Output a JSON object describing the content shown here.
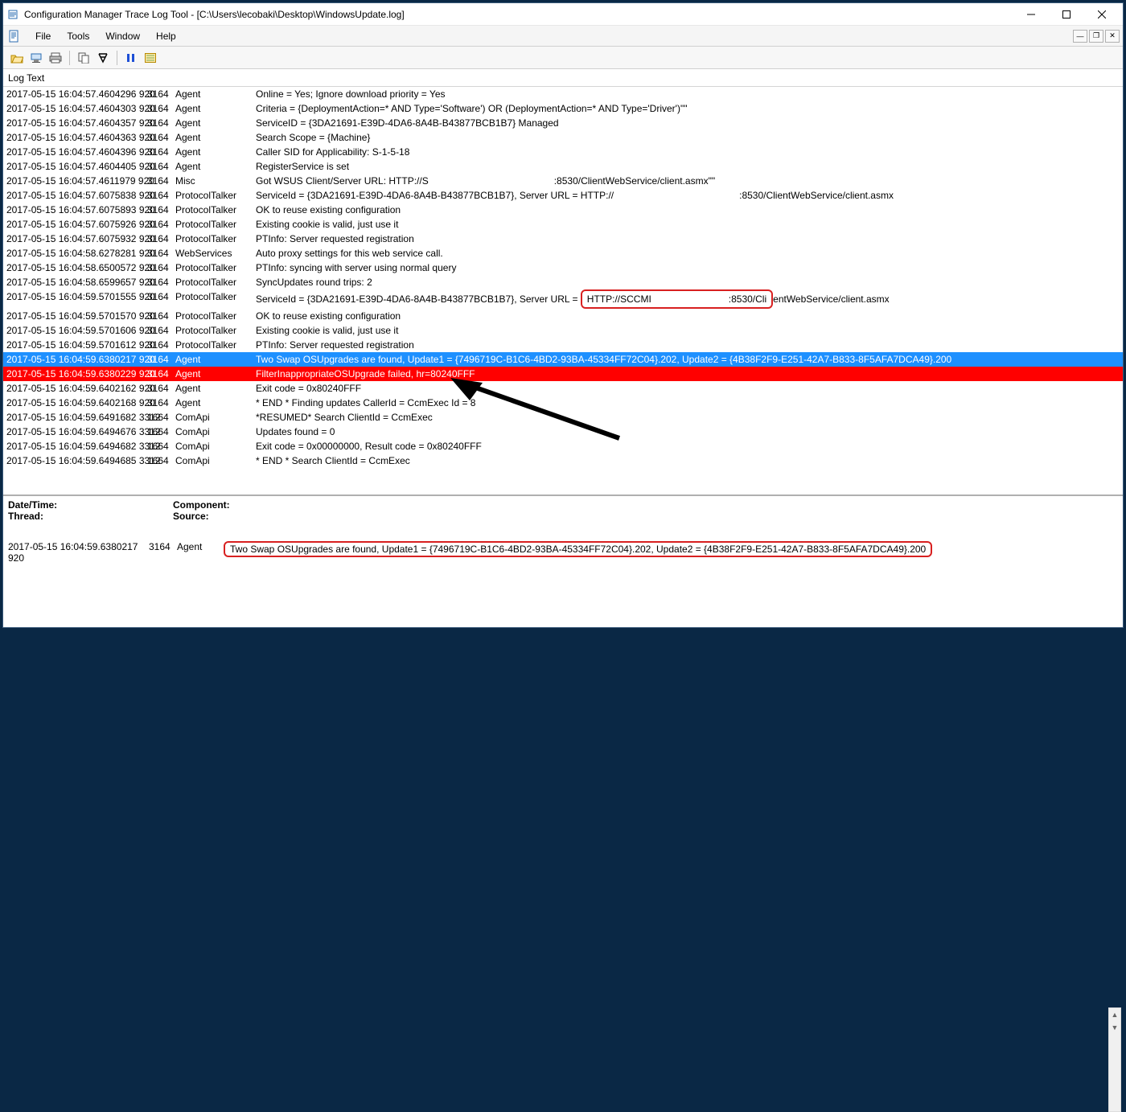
{
  "window": {
    "title": "Configuration Manager Trace Log Tool - [C:\\Users\\lecobaki\\Desktop\\WindowsUpdate.log]"
  },
  "menu": {
    "file": "File",
    "tools": "Tools",
    "window": "Window",
    "help": "Help"
  },
  "grid": {
    "header": "Log Text"
  },
  "rows": [
    {
      "ts": "2017-05-15 16:04:57.4604296 920",
      "pid": "3164",
      "comp": "Agent",
      "msg": "    Online = Yes; Ignore download priority = Yes"
    },
    {
      "ts": "2017-05-15 16:04:57.4604303 920",
      "pid": "3164",
      "comp": "Agent",
      "msg": "    Criteria = {DeploymentAction=* AND Type='Software') OR (DeploymentAction=* AND Type='Driver')\"\""
    },
    {
      "ts": "2017-05-15 16:04:57.4604357 920",
      "pid": "3164",
      "comp": "Agent",
      "msg": "    ServiceID = {3DA21691-E39D-4DA6-8A4B-B43877BCB1B7} Managed"
    },
    {
      "ts": "2017-05-15 16:04:57.4604363 920",
      "pid": "3164",
      "comp": "Agent",
      "msg": "    Search Scope = {Machine}"
    },
    {
      "ts": "2017-05-15 16:04:57.4604396 920",
      "pid": "3164",
      "comp": "Agent",
      "msg": "    Caller SID for Applicability: S-1-5-18"
    },
    {
      "ts": "2017-05-15 16:04:57.4604405 920",
      "pid": "3164",
      "comp": "Agent",
      "msg": "    RegisterService is set"
    },
    {
      "ts": "2017-05-15 16:04:57.4611979 920",
      "pid": "3164",
      "comp": "Misc",
      "msg": "Got WSUS Client/Server URL: HTTP://S             :8530/ClientWebService/client.asmx\"\""
    },
    {
      "ts": "2017-05-15 16:04:57.6075838 920",
      "pid": "3164",
      "comp": "ProtocolTalker",
      "msg": "ServiceId = {3DA21691-E39D-4DA6-8A4B-B43877BCB1B7}, Server URL = HTTP://             :8530/ClientWebService/client.asmx"
    },
    {
      "ts": "2017-05-15 16:04:57.6075893 920",
      "pid": "3164",
      "comp": "ProtocolTalker",
      "msg": "OK to reuse existing configuration"
    },
    {
      "ts": "2017-05-15 16:04:57.6075926 920",
      "pid": "3164",
      "comp": "ProtocolTalker",
      "msg": "Existing cookie is valid, just use it"
    },
    {
      "ts": "2017-05-15 16:04:57.6075932 920",
      "pid": "3164",
      "comp": "ProtocolTalker",
      "msg": "PTInfo: Server requested registration"
    },
    {
      "ts": "2017-05-15 16:04:58.6278281 920",
      "pid": "3164",
      "comp": "WebServices",
      "msg": "Auto proxy settings for this web service call."
    },
    {
      "ts": "2017-05-15 16:04:58.6500572 920",
      "pid": "3164",
      "comp": "ProtocolTalker",
      "msg": "PTInfo: syncing with server using normal query"
    },
    {
      "ts": "2017-05-15 16:04:58.6599657 920",
      "pid": "3164",
      "comp": "ProtocolTalker",
      "msg": "SyncUpdates round trips: 2"
    },
    {
      "ts": "2017-05-15 16:04:59.5701555 920",
      "pid": "3164",
      "comp": "ProtocolTalker",
      "msg_pre": "ServiceId = {3DA21691-E39D-4DA6-8A4B-B43877BCB1B7}, Server URL =",
      "msg_hl": "HTTP://SCCMI        :8530/Cli",
      "msg_post": "entWebService/client.asmx",
      "hl": true
    },
    {
      "ts": "2017-05-15 16:04:59.5701570 920",
      "pid": "3164",
      "comp": "ProtocolTalker",
      "msg": "OK to reuse existing configuration"
    },
    {
      "ts": "2017-05-15 16:04:59.5701606 920",
      "pid": "3164",
      "comp": "ProtocolTalker",
      "msg": "Existing cookie is valid, just use it"
    },
    {
      "ts": "2017-05-15 16:04:59.5701612 920",
      "pid": "3164",
      "comp": "ProtocolTalker",
      "msg": "PTInfo: Server requested registration"
    },
    {
      "ts": "2017-05-15 16:04:59.6380217 920",
      "pid": "3164",
      "comp": "Agent",
      "msg": "Two Swap OSUpgrades are found, Update1 = {7496719C-B1C6-4BD2-93BA-45334FF72C04}.202, Update2 = {4B38F2F9-E251-42A7-B833-8F5AFA7DCA49}.200",
      "cls": "sel"
    },
    {
      "ts": "2017-05-15 16:04:59.6380229 920",
      "pid": "3164",
      "comp": "Agent",
      "msg": "FilterInappropriateOSUpgrade failed, hr=80240FFF",
      "cls": "err"
    },
    {
      "ts": "2017-05-15 16:04:59.6402162 920",
      "pid": "3164",
      "comp": "Agent",
      "msg": "Exit code = 0x80240FFF"
    },
    {
      "ts": "2017-05-15 16:04:59.6402168 920",
      "pid": "3164",
      "comp": "Agent",
      "msg": "* END * Finding updates CallerId = CcmExec  Id = 8"
    },
    {
      "ts": "2017-05-15 16:04:59.6491682 3312",
      "pid": "1664",
      "comp": "ComApi",
      "msg": "    *RESUMED* Search ClientId = CcmExec"
    },
    {
      "ts": "2017-05-15 16:04:59.6494676 3312",
      "pid": "1664",
      "comp": "ComApi",
      "msg": "    Updates found = 0"
    },
    {
      "ts": "2017-05-15 16:04:59.6494682 3312",
      "pid": "1664",
      "comp": "ComApi",
      "msg": "    Exit code = 0x00000000, Result code = 0x80240FFF"
    },
    {
      "ts": "2017-05-15 16:04:59.6494685 3312",
      "pid": "1664",
      "comp": "ComApi",
      "msg": "    * END *   Search ClientId = CcmExec"
    }
  ],
  "detail": {
    "labels": {
      "dt": "Date/Time:",
      "comp": "Component:",
      "thread": "Thread:",
      "src": "Source:"
    },
    "row": {
      "ts": "2017-05-15 16:04:59.6380217 920",
      "pid": "3164",
      "comp": "Agent",
      "msg": "Two Swap OSUpgrades are found, Update1 = {7496719C-B1C6-4BD2-93BA-45334FF72C04}.202, Update2 = {4B38F2F9-E251-42A7-B833-8F5AFA7DCA49}.200"
    }
  }
}
